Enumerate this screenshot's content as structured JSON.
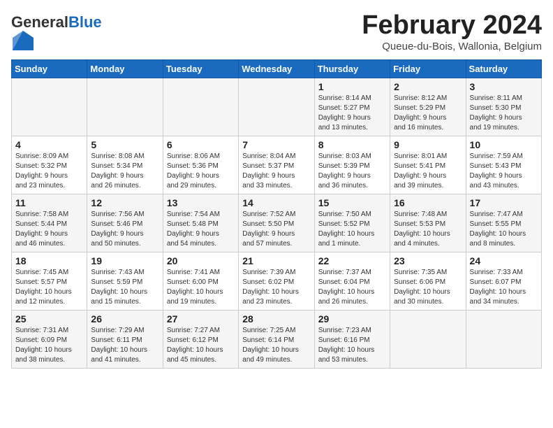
{
  "header": {
    "logo_general": "General",
    "logo_blue": "Blue",
    "month_title": "February 2024",
    "location": "Queue-du-Bois, Wallonia, Belgium"
  },
  "days_of_week": [
    "Sunday",
    "Monday",
    "Tuesday",
    "Wednesday",
    "Thursday",
    "Friday",
    "Saturday"
  ],
  "weeks": [
    [
      {
        "day": "",
        "info": ""
      },
      {
        "day": "",
        "info": ""
      },
      {
        "day": "",
        "info": ""
      },
      {
        "day": "",
        "info": ""
      },
      {
        "day": "1",
        "info": "Sunrise: 8:14 AM\nSunset: 5:27 PM\nDaylight: 9 hours\nand 13 minutes."
      },
      {
        "day": "2",
        "info": "Sunrise: 8:12 AM\nSunset: 5:29 PM\nDaylight: 9 hours\nand 16 minutes."
      },
      {
        "day": "3",
        "info": "Sunrise: 8:11 AM\nSunset: 5:30 PM\nDaylight: 9 hours\nand 19 minutes."
      }
    ],
    [
      {
        "day": "4",
        "info": "Sunrise: 8:09 AM\nSunset: 5:32 PM\nDaylight: 9 hours\nand 23 minutes."
      },
      {
        "day": "5",
        "info": "Sunrise: 8:08 AM\nSunset: 5:34 PM\nDaylight: 9 hours\nand 26 minutes."
      },
      {
        "day": "6",
        "info": "Sunrise: 8:06 AM\nSunset: 5:36 PM\nDaylight: 9 hours\nand 29 minutes."
      },
      {
        "day": "7",
        "info": "Sunrise: 8:04 AM\nSunset: 5:37 PM\nDaylight: 9 hours\nand 33 minutes."
      },
      {
        "day": "8",
        "info": "Sunrise: 8:03 AM\nSunset: 5:39 PM\nDaylight: 9 hours\nand 36 minutes."
      },
      {
        "day": "9",
        "info": "Sunrise: 8:01 AM\nSunset: 5:41 PM\nDaylight: 9 hours\nand 39 minutes."
      },
      {
        "day": "10",
        "info": "Sunrise: 7:59 AM\nSunset: 5:43 PM\nDaylight: 9 hours\nand 43 minutes."
      }
    ],
    [
      {
        "day": "11",
        "info": "Sunrise: 7:58 AM\nSunset: 5:44 PM\nDaylight: 9 hours\nand 46 minutes."
      },
      {
        "day": "12",
        "info": "Sunrise: 7:56 AM\nSunset: 5:46 PM\nDaylight: 9 hours\nand 50 minutes."
      },
      {
        "day": "13",
        "info": "Sunrise: 7:54 AM\nSunset: 5:48 PM\nDaylight: 9 hours\nand 54 minutes."
      },
      {
        "day": "14",
        "info": "Sunrise: 7:52 AM\nSunset: 5:50 PM\nDaylight: 9 hours\nand 57 minutes."
      },
      {
        "day": "15",
        "info": "Sunrise: 7:50 AM\nSunset: 5:52 PM\nDaylight: 10 hours\nand 1 minute."
      },
      {
        "day": "16",
        "info": "Sunrise: 7:48 AM\nSunset: 5:53 PM\nDaylight: 10 hours\nand 4 minutes."
      },
      {
        "day": "17",
        "info": "Sunrise: 7:47 AM\nSunset: 5:55 PM\nDaylight: 10 hours\nand 8 minutes."
      }
    ],
    [
      {
        "day": "18",
        "info": "Sunrise: 7:45 AM\nSunset: 5:57 PM\nDaylight: 10 hours\nand 12 minutes."
      },
      {
        "day": "19",
        "info": "Sunrise: 7:43 AM\nSunset: 5:59 PM\nDaylight: 10 hours\nand 15 minutes."
      },
      {
        "day": "20",
        "info": "Sunrise: 7:41 AM\nSunset: 6:00 PM\nDaylight: 10 hours\nand 19 minutes."
      },
      {
        "day": "21",
        "info": "Sunrise: 7:39 AM\nSunset: 6:02 PM\nDaylight: 10 hours\nand 23 minutes."
      },
      {
        "day": "22",
        "info": "Sunrise: 7:37 AM\nSunset: 6:04 PM\nDaylight: 10 hours\nand 26 minutes."
      },
      {
        "day": "23",
        "info": "Sunrise: 7:35 AM\nSunset: 6:06 PM\nDaylight: 10 hours\nand 30 minutes."
      },
      {
        "day": "24",
        "info": "Sunrise: 7:33 AM\nSunset: 6:07 PM\nDaylight: 10 hours\nand 34 minutes."
      }
    ],
    [
      {
        "day": "25",
        "info": "Sunrise: 7:31 AM\nSunset: 6:09 PM\nDaylight: 10 hours\nand 38 minutes."
      },
      {
        "day": "26",
        "info": "Sunrise: 7:29 AM\nSunset: 6:11 PM\nDaylight: 10 hours\nand 41 minutes."
      },
      {
        "day": "27",
        "info": "Sunrise: 7:27 AM\nSunset: 6:12 PM\nDaylight: 10 hours\nand 45 minutes."
      },
      {
        "day": "28",
        "info": "Sunrise: 7:25 AM\nSunset: 6:14 PM\nDaylight: 10 hours\nand 49 minutes."
      },
      {
        "day": "29",
        "info": "Sunrise: 7:23 AM\nSunset: 6:16 PM\nDaylight: 10 hours\nand 53 minutes."
      },
      {
        "day": "",
        "info": ""
      },
      {
        "day": "",
        "info": ""
      }
    ]
  ]
}
